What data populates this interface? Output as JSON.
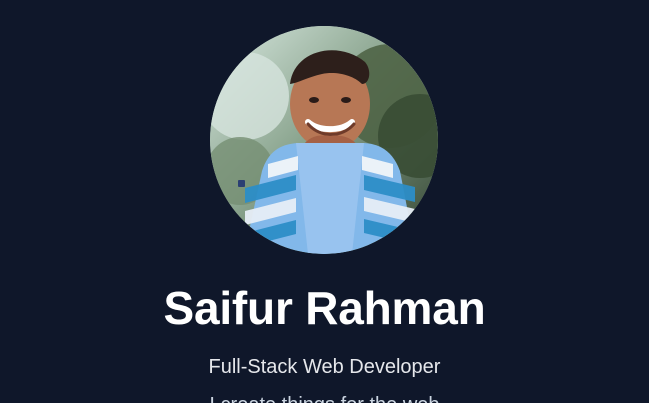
{
  "profile": {
    "name": "Saifur Rahman",
    "title": "Full-Stack Web Developer",
    "intro_line_partial": "I create things for the web"
  },
  "theme": {
    "background": "#0f172a",
    "text_primary": "#ffffff",
    "text_secondary": "#e5e7eb"
  },
  "icons": {
    "avatar": "profile-photo"
  }
}
